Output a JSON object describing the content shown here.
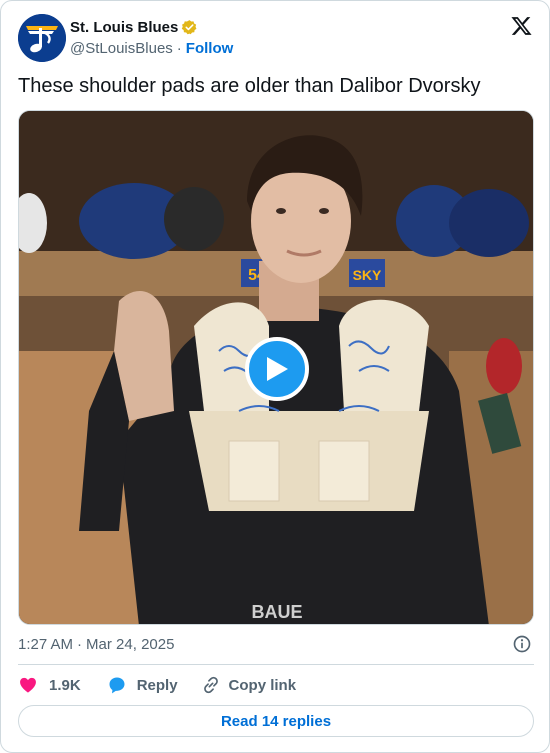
{
  "author": {
    "display_name": "St. Louis Blues",
    "handle": "@StLouisBlues",
    "separator": "·",
    "follow_label": "Follow"
  },
  "tweet": {
    "text": "These shoulder pads are older than Dalibor Dvorsky"
  },
  "media": {
    "type": "video",
    "nameplate_number": "54",
    "nameplate_text": "SKY",
    "shirt_text": "BAUE"
  },
  "meta": {
    "time": "1:27 AM",
    "separator": "·",
    "date": "Mar 24, 2025"
  },
  "actions": {
    "like_count": "1.9K",
    "reply_label": "Reply",
    "copy_label": "Copy link"
  },
  "footer": {
    "read_replies_label": "Read 14 replies"
  },
  "colors": {
    "brand_blue": "#1d9bf0",
    "link_blue": "#006fd6",
    "like_red": "#f91880",
    "verified_gold": "#e2b719",
    "secondary_text": "#536471",
    "border": "#cfd9de",
    "blues_navy": "#0b3d8f"
  },
  "icons": [
    "blues-note-logo",
    "verified-badge-icon",
    "x-logo-icon",
    "play-icon",
    "info-icon",
    "heart-icon",
    "reply-bubble-icon",
    "link-icon"
  ]
}
